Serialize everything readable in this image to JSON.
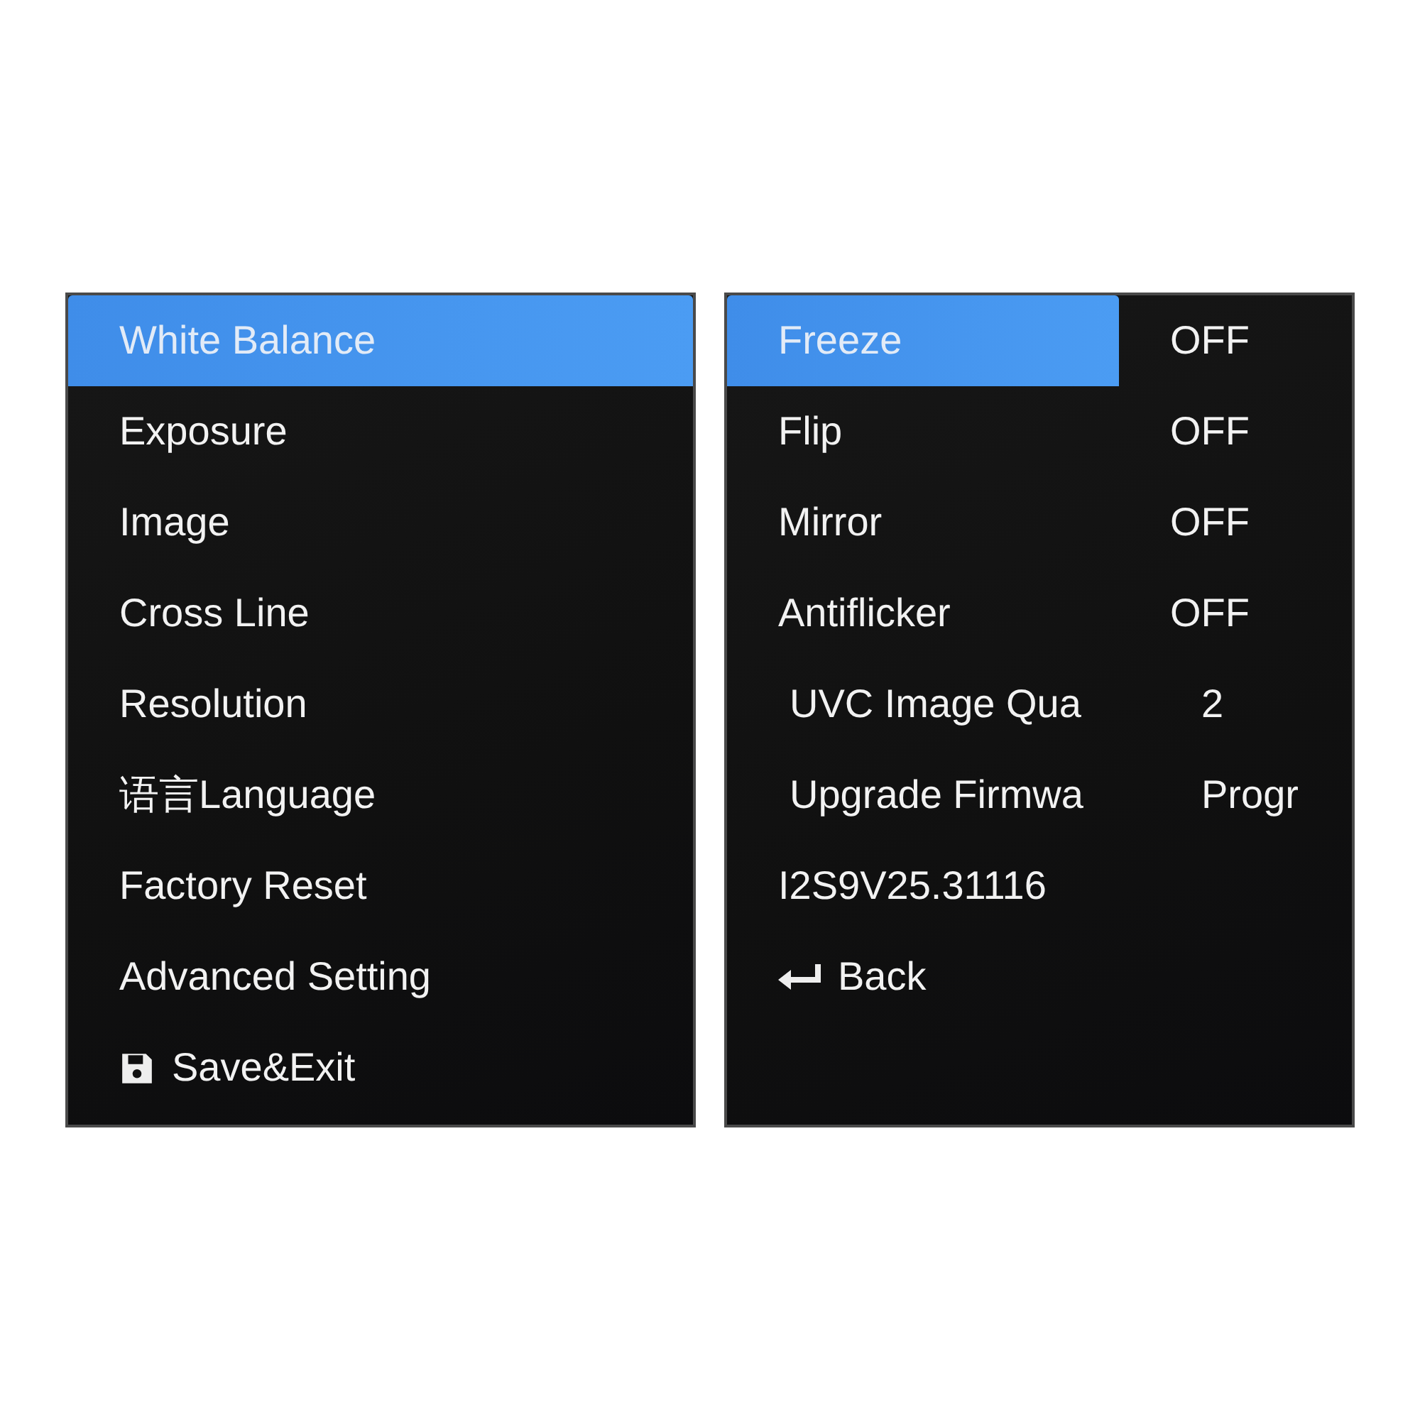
{
  "menus": [
    {
      "items": [
        {
          "kind": "entry",
          "label": "White Balance",
          "selected": true
        },
        {
          "kind": "entry",
          "label": "Exposure",
          "selected": false
        },
        {
          "kind": "entry",
          "label": "Image",
          "selected": false
        },
        {
          "kind": "entry",
          "label": "Cross Line",
          "selected": false
        },
        {
          "kind": "entry",
          "label": "Resolution",
          "selected": false
        },
        {
          "kind": "entry",
          "label": "语言Language",
          "selected": false
        },
        {
          "kind": "entry",
          "label": "Factory Reset",
          "selected": false
        },
        {
          "kind": "entry",
          "label": "Advanced Setting",
          "selected": false
        },
        {
          "kind": "save",
          "label": "Save&Exit",
          "selected": false
        }
      ]
    },
    {
      "items": [
        {
          "kind": "toggle",
          "label": "Freeze",
          "value": "OFF",
          "selected": true
        },
        {
          "kind": "toggle",
          "label": "Flip",
          "value": "OFF",
          "selected": false
        },
        {
          "kind": "toggle",
          "label": "Mirror",
          "value": "OFF",
          "selected": false
        },
        {
          "kind": "toggle",
          "label": "Antiflicker",
          "value": "OFF",
          "selected": false
        },
        {
          "kind": "option",
          "label": "UVC Image Qua",
          "value": "2",
          "selected": false
        },
        {
          "kind": "option",
          "label": "Upgrade Firmwa",
          "value": "Progr",
          "selected": false
        },
        {
          "kind": "info",
          "label": "I2S9V25.31116",
          "selected": false
        },
        {
          "kind": "back",
          "label": "Back",
          "selected": false
        }
      ]
    }
  ]
}
